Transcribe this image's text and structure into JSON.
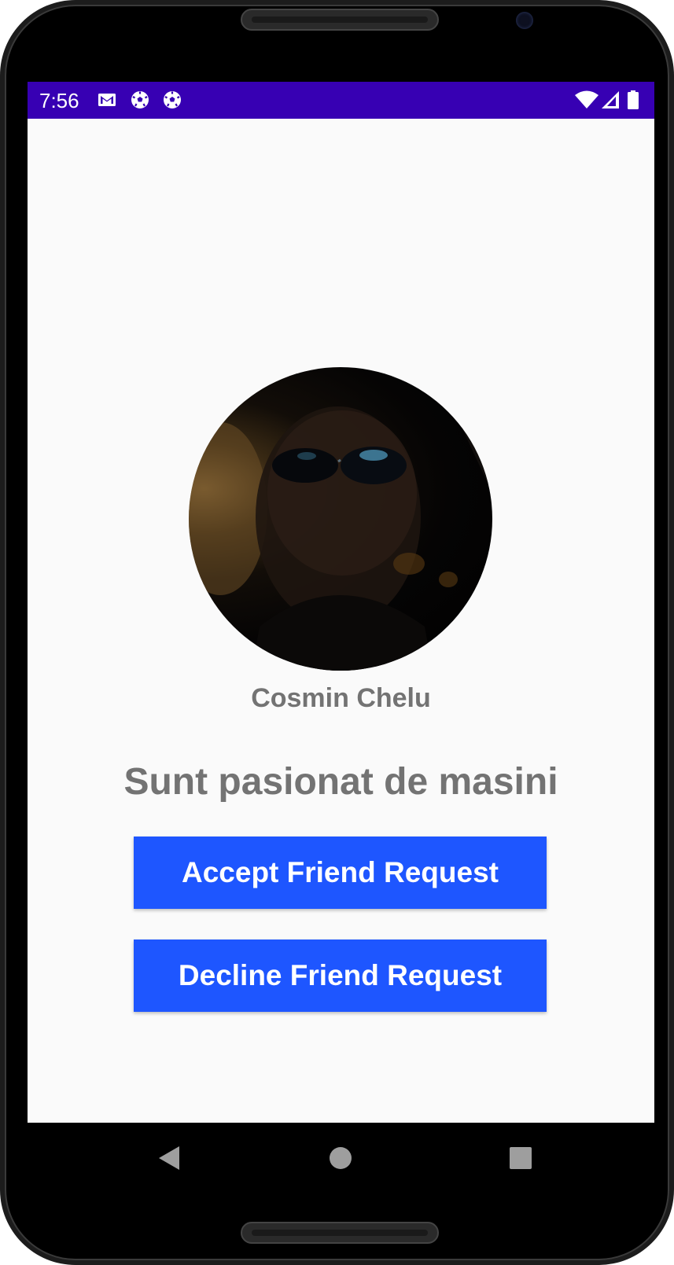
{
  "status_bar": {
    "time": "7:56",
    "left_icons": [
      "gmail-icon",
      "soccer-ball-icon",
      "soccer-ball-icon"
    ],
    "right_icons": [
      "wifi-icon",
      "cell-signal-icon",
      "battery-icon"
    ],
    "color": "#3700b3"
  },
  "profile": {
    "avatar": "profile-photo",
    "name": "Cosmin Chelu",
    "bio": "Sunt pasionat de masini"
  },
  "actions": {
    "accept_label": "Accept Friend Request",
    "decline_label": "Decline Friend Request",
    "button_color": "#1e56ff"
  },
  "nav_bar": {
    "buttons": [
      "back-icon",
      "home-icon",
      "recents-icon"
    ]
  }
}
